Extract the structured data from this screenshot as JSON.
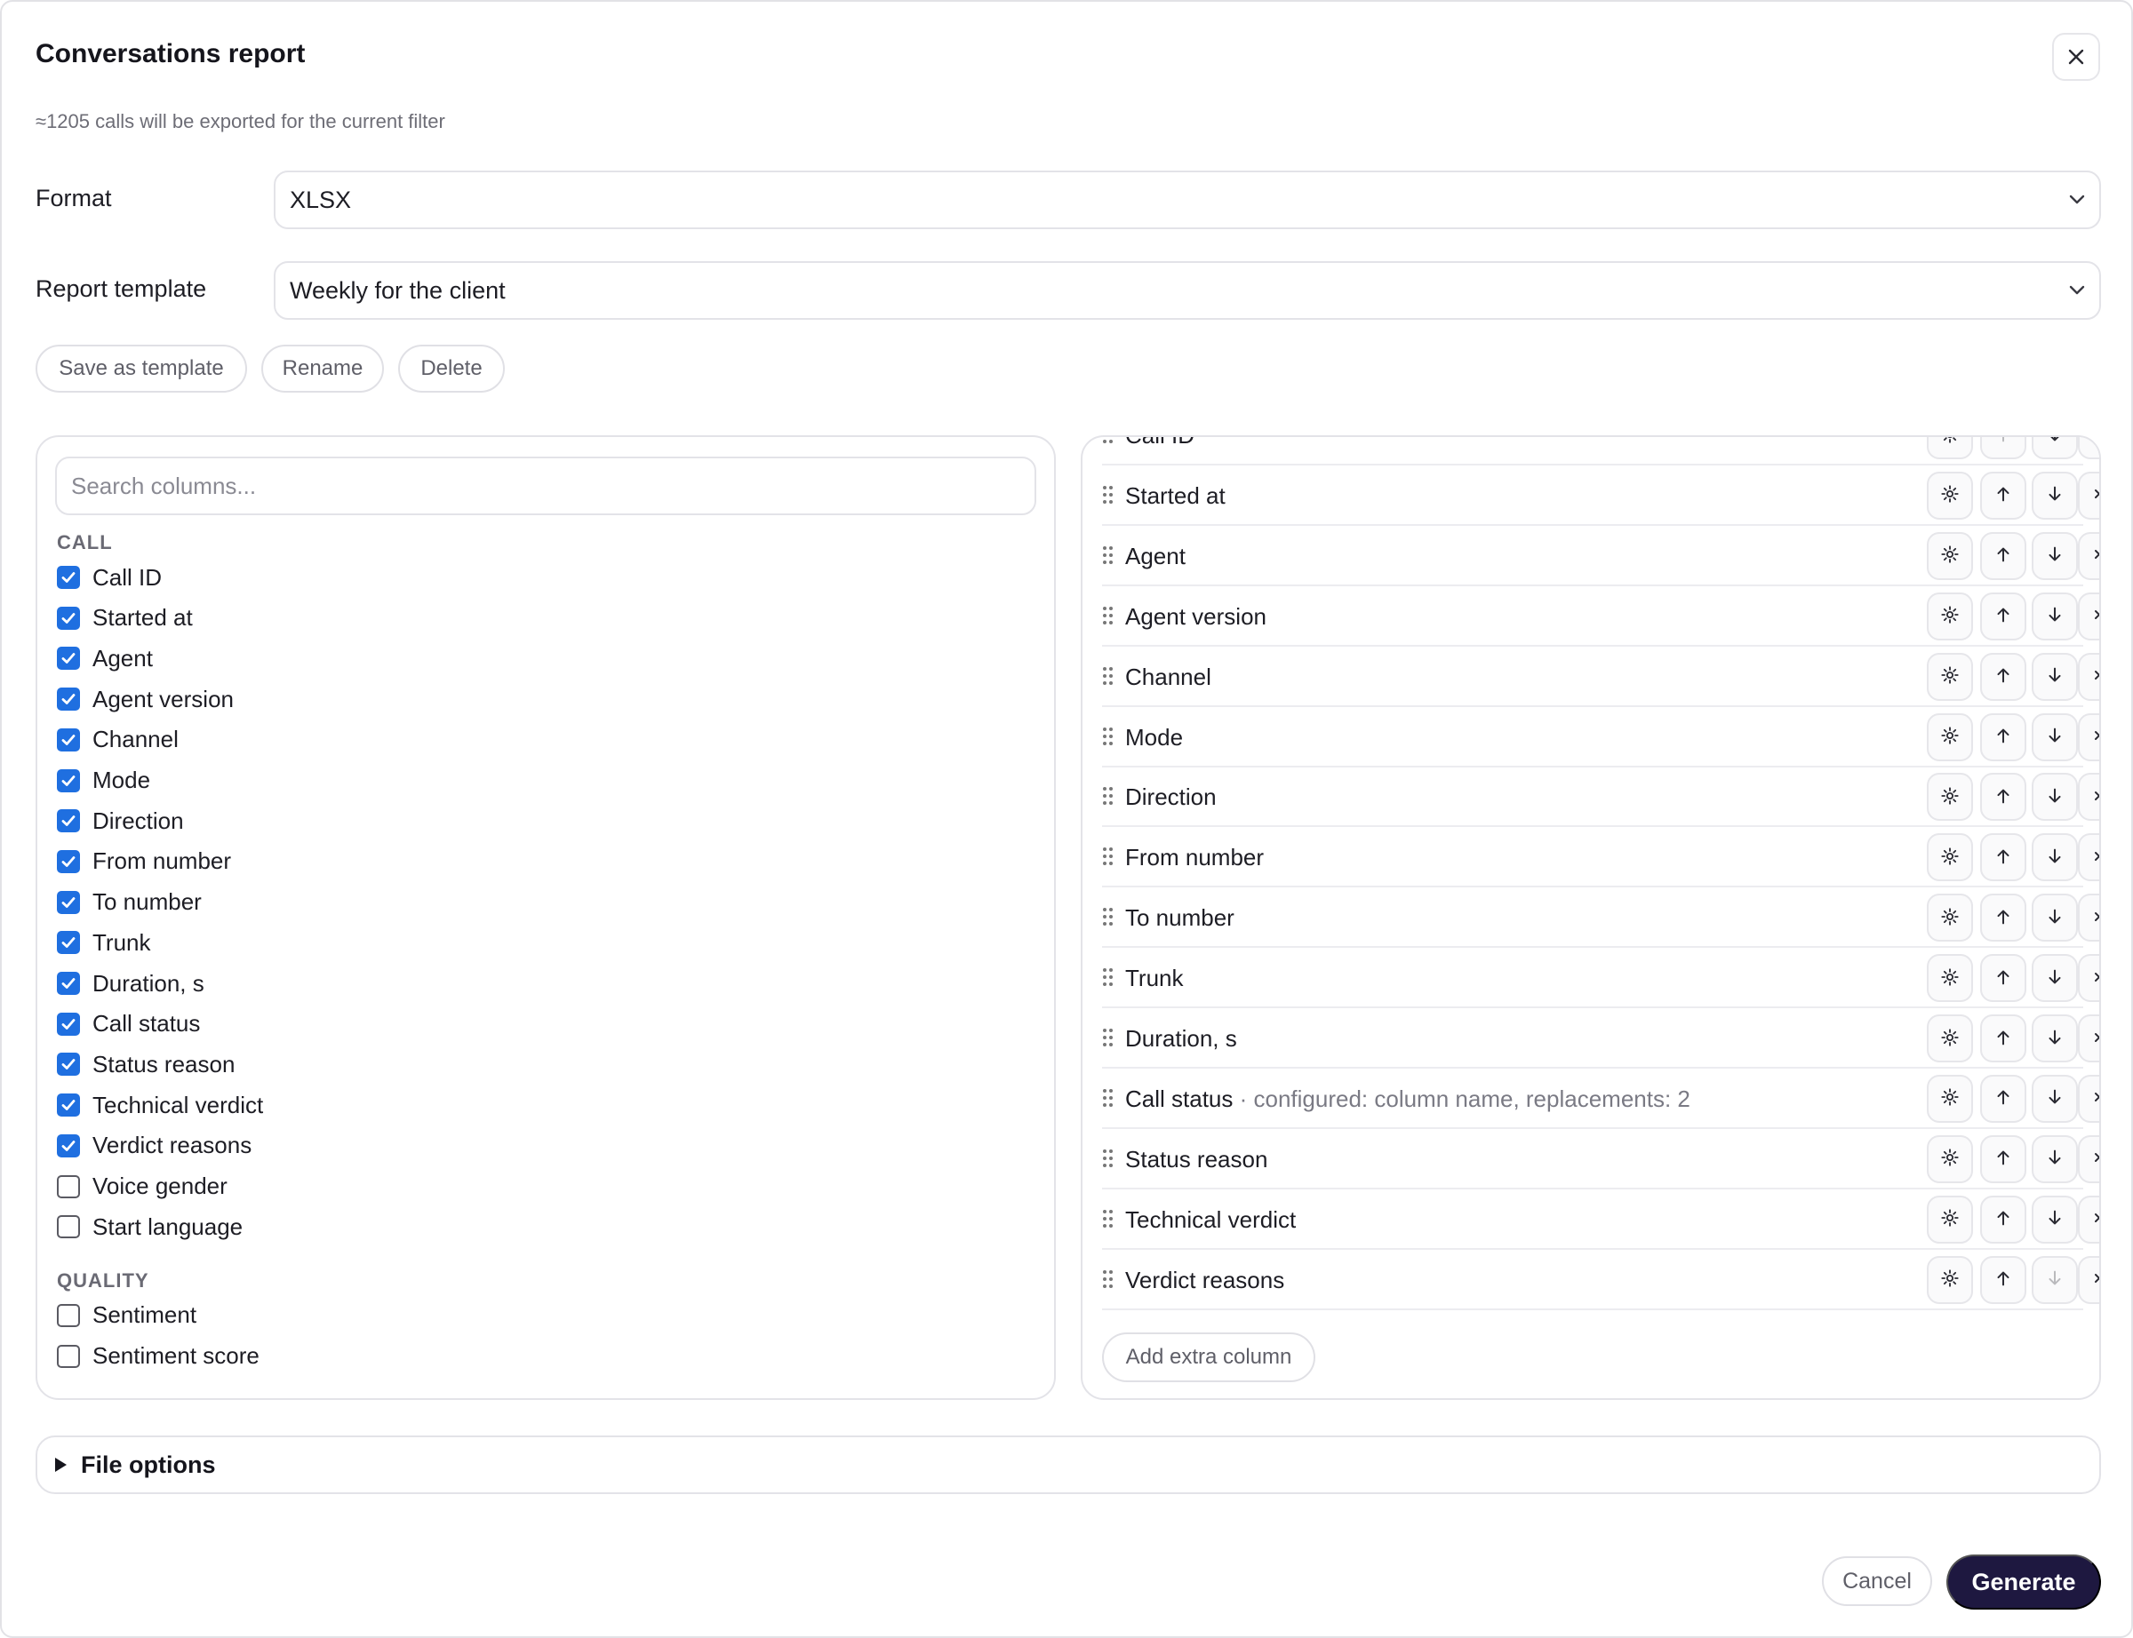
{
  "dialog": {
    "title": "Conversations report",
    "subtitle": "≈1205 calls will be exported for the current filter"
  },
  "format": {
    "label": "Format",
    "value": "XLSX"
  },
  "template": {
    "label": "Report template",
    "value": "Weekly for the client"
  },
  "template_actions": {
    "save": "Save as template",
    "rename": "Rename",
    "delete": "Delete"
  },
  "columns_picker": {
    "search_placeholder": "Search columns...",
    "groups": [
      {
        "heading": "CALL",
        "items": [
          {
            "label": "Call ID",
            "checked": true
          },
          {
            "label": "Started at",
            "checked": true
          },
          {
            "label": "Agent",
            "checked": true
          },
          {
            "label": "Agent version",
            "checked": true
          },
          {
            "label": "Channel",
            "checked": true
          },
          {
            "label": "Mode",
            "checked": true
          },
          {
            "label": "Direction",
            "checked": true
          },
          {
            "label": "From number",
            "checked": true
          },
          {
            "label": "To number",
            "checked": true
          },
          {
            "label": "Trunk",
            "checked": true
          },
          {
            "label": "Duration, s",
            "checked": true
          },
          {
            "label": "Call status",
            "checked": true
          },
          {
            "label": "Status reason",
            "checked": true
          },
          {
            "label": "Technical verdict",
            "checked": true
          },
          {
            "label": "Verdict reasons",
            "checked": true
          },
          {
            "label": "Voice gender",
            "checked": false
          },
          {
            "label": "Start language",
            "checked": false
          }
        ]
      },
      {
        "heading": "QUALITY",
        "items": [
          {
            "label": "Sentiment",
            "checked": false
          },
          {
            "label": "Sentiment score",
            "checked": false
          }
        ]
      }
    ]
  },
  "selected_columns": {
    "rows": [
      {
        "label": "Call ID",
        "note": "",
        "up_disabled": true,
        "down_disabled": false
      },
      {
        "label": "Started at",
        "note": "",
        "up_disabled": false,
        "down_disabled": false
      },
      {
        "label": "Agent",
        "note": "",
        "up_disabled": false,
        "down_disabled": false
      },
      {
        "label": "Agent version",
        "note": "",
        "up_disabled": false,
        "down_disabled": false
      },
      {
        "label": "Channel",
        "note": "",
        "up_disabled": false,
        "down_disabled": false
      },
      {
        "label": "Mode",
        "note": "",
        "up_disabled": false,
        "down_disabled": false
      },
      {
        "label": "Direction",
        "note": "",
        "up_disabled": false,
        "down_disabled": false
      },
      {
        "label": "From number",
        "note": "",
        "up_disabled": false,
        "down_disabled": false
      },
      {
        "label": "To number",
        "note": "",
        "up_disabled": false,
        "down_disabled": false
      },
      {
        "label": "Trunk",
        "note": "",
        "up_disabled": false,
        "down_disabled": false
      },
      {
        "label": "Duration, s",
        "note": "",
        "up_disabled": false,
        "down_disabled": false
      },
      {
        "label": "Call status",
        "note": " · configured: column name, replacements: 2",
        "up_disabled": false,
        "down_disabled": false
      },
      {
        "label": "Status reason",
        "note": "",
        "up_disabled": false,
        "down_disabled": false
      },
      {
        "label": "Technical verdict",
        "note": "",
        "up_disabled": false,
        "down_disabled": false
      },
      {
        "label": "Verdict reasons",
        "note": "",
        "up_disabled": false,
        "down_disabled": true
      }
    ],
    "add_button": "Add extra column"
  },
  "file_options": {
    "label": "File options"
  },
  "footer": {
    "cancel": "Cancel",
    "generate": "Generate"
  },
  "colors": {
    "accent": "#1f6fe0",
    "primary_button": "#1e1840",
    "border": "#e3e3e8"
  }
}
